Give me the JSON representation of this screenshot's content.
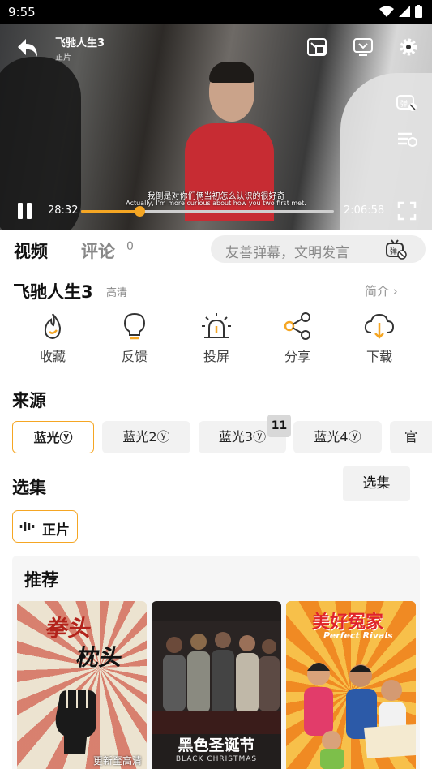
{
  "status_bar": {
    "time": "9:55"
  },
  "player": {
    "title": "飞驰人生3",
    "subtitle": "正片",
    "subtitle_cn": "我倒是对你们俩当初怎么认识的很好奇",
    "subtitle_en": "Actually, I'm more curious about how you two first met.",
    "current_time": "28:32",
    "total_time": "2:06:58",
    "progress": 0.23,
    "accent_color": "#f5a623"
  },
  "tabs": {
    "video": "视频",
    "comments": "评论",
    "comments_count": "0"
  },
  "danmu": {
    "placeholder": "友善弹幕，文明发言"
  },
  "video": {
    "title": "飞驰人生3",
    "quality": "高清",
    "intro_label": "简介 ›"
  },
  "actions": [
    {
      "label": "收藏",
      "icon": "favorite-icon"
    },
    {
      "label": "反馈",
      "icon": "feedback-icon"
    },
    {
      "label": "投屏",
      "icon": "cast-icon"
    },
    {
      "label": "分享",
      "icon": "share-icon"
    },
    {
      "label": "下载",
      "icon": "download-icon"
    }
  ],
  "sources": {
    "heading": "来源",
    "items": [
      "蓝光ⓨ",
      "蓝光2ⓨ",
      "蓝光3ⓨ",
      "蓝光4ⓨ",
      "官"
    ],
    "badge": "11"
  },
  "episodes": {
    "heading": "选集",
    "button": "选集",
    "items": [
      "正片"
    ]
  },
  "recommend": {
    "heading": "推荐",
    "items": [
      {
        "title_a": "拳头",
        "title_b": "枕头",
        "note": "更新至高清"
      },
      {
        "title_a": "黑色圣诞节",
        "title_b": "BLACK CHRISTMAS"
      },
      {
        "title_a": "美好冤家",
        "title_b": "Perfect Rivals"
      }
    ]
  }
}
